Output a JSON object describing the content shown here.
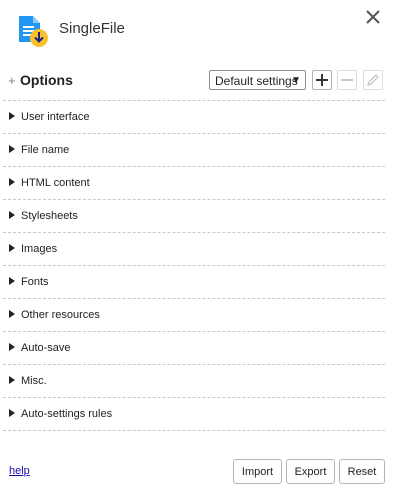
{
  "app": {
    "title": "SingleFile",
    "logo_icon": "singlefile-download-icon",
    "close_icon": "close-icon"
  },
  "options": {
    "toggle_symbol": "+",
    "title": "Options",
    "profile_selected": "Default settings",
    "add_icon": "plus-icon",
    "remove_icon": "minus-icon",
    "rename_icon": "pencil-icon"
  },
  "sections": [
    {
      "label": "User interface"
    },
    {
      "label": "File name"
    },
    {
      "label": "HTML content"
    },
    {
      "label": "Stylesheets"
    },
    {
      "label": "Images"
    },
    {
      "label": "Fonts"
    },
    {
      "label": "Other resources"
    },
    {
      "label": "Auto-save"
    },
    {
      "label": "Misc."
    },
    {
      "label": "Auto-settings rules"
    }
  ],
  "footer": {
    "help_label": "help",
    "import_label": "Import",
    "export_label": "Export",
    "reset_label": "Reset"
  },
  "colors": {
    "logo_blue": "#2196f3",
    "logo_yellow": "#fbc02d",
    "link": "#1a0dab"
  }
}
